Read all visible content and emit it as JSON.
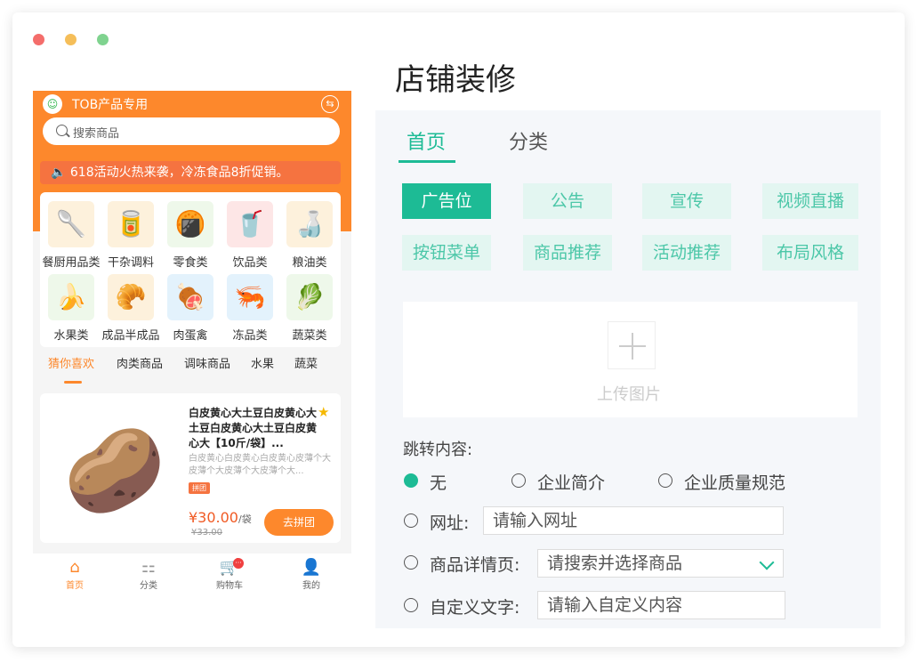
{
  "page_title": "店铺装修",
  "phone": {
    "store_name": "TOB产品专用",
    "search_placeholder": "搜索商品",
    "notice": "🔈 618活动火热来袭，冷冻食品8折促销。",
    "categories": [
      {
        "label": "餐厨用品类",
        "icon": "🥄",
        "bg": "#fdf1dc"
      },
      {
        "label": "干杂调料",
        "icon": "🥫",
        "bg": "#fdf1dc"
      },
      {
        "label": "零食类",
        "icon": "🍘",
        "bg": "#eef8ea"
      },
      {
        "label": "饮品类",
        "icon": "🥤",
        "bg": "#fde6e6"
      },
      {
        "label": "粮油类",
        "icon": "🍶",
        "bg": "#fdf1dc"
      },
      {
        "label": "水果类",
        "icon": "🍌",
        "bg": "#eef8ea"
      },
      {
        "label": "成品半成品",
        "icon": "🥐",
        "bg": "#fdf1dc"
      },
      {
        "label": "肉蛋禽",
        "icon": "🍖",
        "bg": "#e3f2fc"
      },
      {
        "label": "冻品类",
        "icon": "🦐",
        "bg": "#e3f2fc"
      },
      {
        "label": "蔬菜类",
        "icon": "🥬",
        "bg": "#eef8ea"
      }
    ],
    "tabs": [
      "猜你喜欢",
      "肉类商品",
      "调味商品",
      "水果",
      "蔬菜"
    ],
    "product": {
      "title": "白皮黄心大土豆白皮黄心大土豆白皮黄心大土豆白皮黄心大【10斤/袋】...",
      "desc": "白皮黄心白皮黄心白皮黄心皮薄个大皮薄个大皮薄个大皮薄个大...",
      "badge": "拼团",
      "price": "¥30.00",
      "unit": "/袋",
      "old_price": "¥33.00",
      "button": "去拼团",
      "icon": "🥔"
    },
    "nav": [
      {
        "label": "首页",
        "icon": "⌂"
      },
      {
        "label": "分类",
        "icon": "⚏"
      },
      {
        "label": "购物车",
        "icon": "🛒",
        "badge": "···"
      },
      {
        "label": "我的",
        "icon": "👤"
      }
    ]
  },
  "editor": {
    "tabs": [
      "首页",
      "分类"
    ],
    "chips": [
      "广告位",
      "公告",
      "宣传",
      "视频直播",
      "按钮菜单",
      "商品推荐",
      "活动推荐",
      "布局风格"
    ],
    "upload_text": "上传图片",
    "jump_label": "跳转内容:",
    "options": {
      "none": "无",
      "intro": "企业简介",
      "quality": "企业质量规范",
      "url": "网址:",
      "detail": "商品详情页:",
      "custom": "自定义文字:"
    },
    "url_placeholder": "请输入网址",
    "detail_placeholder": "请搜索并选择商品",
    "custom_placeholder": "请输入自定义内容"
  },
  "colors": {
    "accent": "#1dbb95",
    "phone_brand": "#fd882c"
  }
}
